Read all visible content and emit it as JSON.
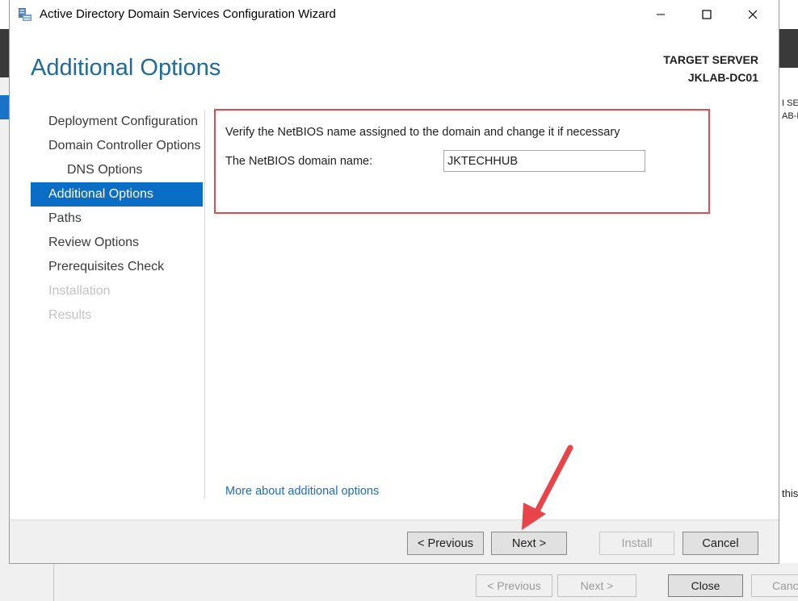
{
  "dialog": {
    "title": "Active Directory Domain Services Configuration Wizard",
    "page_title": "Additional Options",
    "target_server_label": "TARGET SERVER",
    "target_server_name": "JKLAB-DC01"
  },
  "nav": {
    "items": [
      {
        "label": "Deployment Configuration",
        "state": "normal"
      },
      {
        "label": "Domain Controller Options",
        "state": "normal"
      },
      {
        "label": "DNS Options",
        "state": "sub"
      },
      {
        "label": "Additional Options",
        "state": "selected"
      },
      {
        "label": "Paths",
        "state": "normal"
      },
      {
        "label": "Review Options",
        "state": "normal"
      },
      {
        "label": "Prerequisites Check",
        "state": "normal"
      },
      {
        "label": "Installation",
        "state": "disabled"
      },
      {
        "label": "Results",
        "state": "disabled"
      }
    ]
  },
  "content": {
    "instruction": "Verify the NetBIOS name assigned to the domain and change it if necessary",
    "netbios_label": "The NetBIOS domain name:",
    "netbios_value": "JKTECHHUB",
    "more_link": "More about additional options"
  },
  "footer": {
    "previous_label": "< Previous",
    "next_label": "Next >",
    "install_label": "Install",
    "cancel_label": "Cancel"
  },
  "background_window": {
    "previous_label": "< Previous",
    "next_label": "Next >",
    "close_label": "Close",
    "cancel_partial": "Canc",
    "right_text_1": "I SER",
    "right_text_2": "AB-D",
    "right_text_3": "this"
  },
  "colors": {
    "accent": "#0a6ec6",
    "title_blue": "#1f6b9a",
    "link": "#1f6bb8",
    "highlight": "#e24c4c"
  },
  "icons": {
    "app": "server-wizard-icon",
    "annotation": "red-arrow-icon"
  }
}
